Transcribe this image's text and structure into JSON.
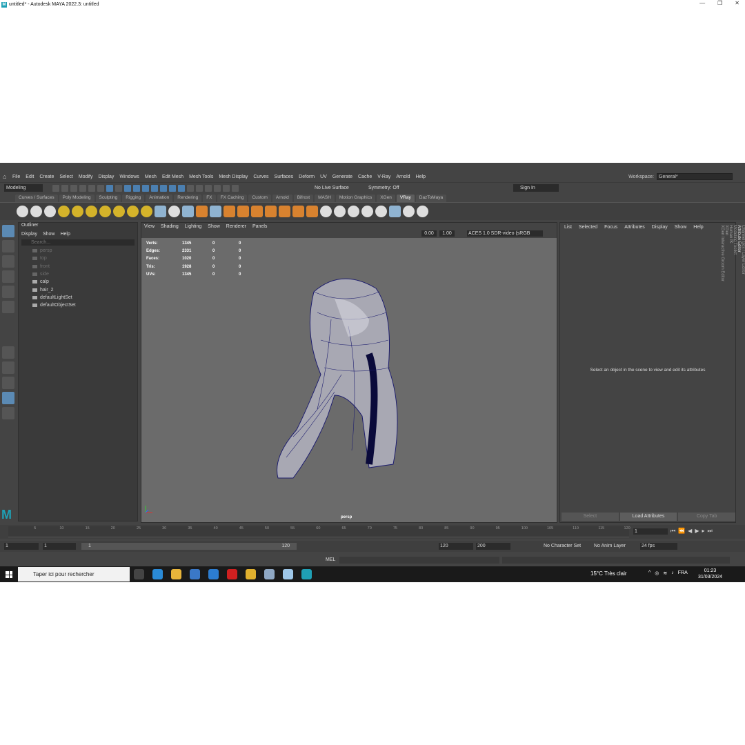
{
  "window": {
    "title": "untitled* - Autodesk MAYA 2022.3: untitled"
  },
  "menubar": [
    "File",
    "Edit",
    "Create",
    "Select",
    "Modify",
    "Display",
    "Windows",
    "Mesh",
    "Edit Mesh",
    "Mesh Tools",
    "Mesh Display",
    "Curves",
    "Surfaces",
    "Deform",
    "UV",
    "Generate",
    "Cache",
    "V-Ray",
    "Arnold",
    "Help"
  ],
  "workspace": {
    "label": "Workspace:",
    "value": "General*"
  },
  "status": {
    "mode": "Modeling",
    "live_surface": "No Live Surface",
    "symmetry": "Symmetry: Off",
    "sign_in": "Sign In"
  },
  "shelf_tabs": [
    "Curves / Surfaces",
    "Poly Modeling",
    "Sculpting",
    "Rigging",
    "Animation",
    "Rendering",
    "FX",
    "FX Caching",
    "Custom",
    "Arnold",
    "Bifrost",
    "MASH",
    "Motion Graphics",
    "XGen",
    "VRay",
    "DazToMaya"
  ],
  "shelf_active": "VRay",
  "outliner": {
    "title": "Outliner",
    "menu": [
      "Display",
      "Show",
      "Help"
    ],
    "search_placeholder": "Search...",
    "items": [
      {
        "label": "persp",
        "dim": true
      },
      {
        "label": "top",
        "dim": true
      },
      {
        "label": "front",
        "dim": true
      },
      {
        "label": "side",
        "dim": true
      },
      {
        "label": "calp",
        "dim": false
      },
      {
        "label": "hair_2",
        "dim": false
      },
      {
        "label": "defaultLightSet",
        "dim": false
      },
      {
        "label": "defaultObjectSet",
        "dim": false
      }
    ]
  },
  "viewport": {
    "menu": [
      "View",
      "Shading",
      "Lighting",
      "Show",
      "Renderer",
      "Panels"
    ],
    "exposure": "0.00",
    "gamma": "1.00",
    "color_space": "ACES 1.0 SDR-video (sRGB",
    "camera": "persp",
    "hud": [
      {
        "label": "Verts:",
        "a": "1345",
        "b": "0",
        "c": "0"
      },
      {
        "label": "Edges:",
        "a": "2331",
        "b": "0",
        "c": "0"
      },
      {
        "label": "Faces:",
        "a": "1020",
        "b": "0",
        "c": "0"
      },
      {
        "label": "Tris:",
        "a": "1928",
        "b": "0",
        "c": "0"
      },
      {
        "label": "UVs:",
        "a": "1345",
        "b": "0",
        "c": "0"
      }
    ]
  },
  "attribute_editor": {
    "menu": [
      "List",
      "Selected",
      "Focus",
      "Attributes",
      "Display",
      "Show",
      "Help"
    ],
    "message": "Select an object in the scene to view and edit its attributes",
    "buttons": {
      "select": "Select",
      "load": "Load Attributes",
      "copy": "Copy Tab"
    }
  },
  "side_tabs": [
    "Channel Box / Layer Editor",
    "Attribute Editor",
    "Modeling Toolkit",
    "Human IK",
    "XGen",
    "XGen Interactive Groom Editor"
  ],
  "timeline": {
    "ticks": [
      "5",
      "10",
      "15",
      "20",
      "25",
      "30",
      "35",
      "40",
      "45",
      "50",
      "55",
      "60",
      "65",
      "70",
      "75",
      "80",
      "85",
      "90",
      "95",
      "100",
      "105",
      "110",
      "115",
      "120"
    ],
    "current_frame": "1"
  },
  "range": {
    "start": "1",
    "start_inner": "1",
    "bar_start": "1",
    "bar_end": "120",
    "end_inner": "120",
    "end": "200",
    "character_set": "No Character Set",
    "anim_layer": "No Anim Layer",
    "fps": "24 fps"
  },
  "cmdline": {
    "lang": "MEL"
  },
  "taskbar": {
    "search": "Taper ici pour rechercher",
    "weather": "15°C  Très clair",
    "lang": "FRA",
    "time": "01:23",
    "date": "31/03/2024"
  }
}
